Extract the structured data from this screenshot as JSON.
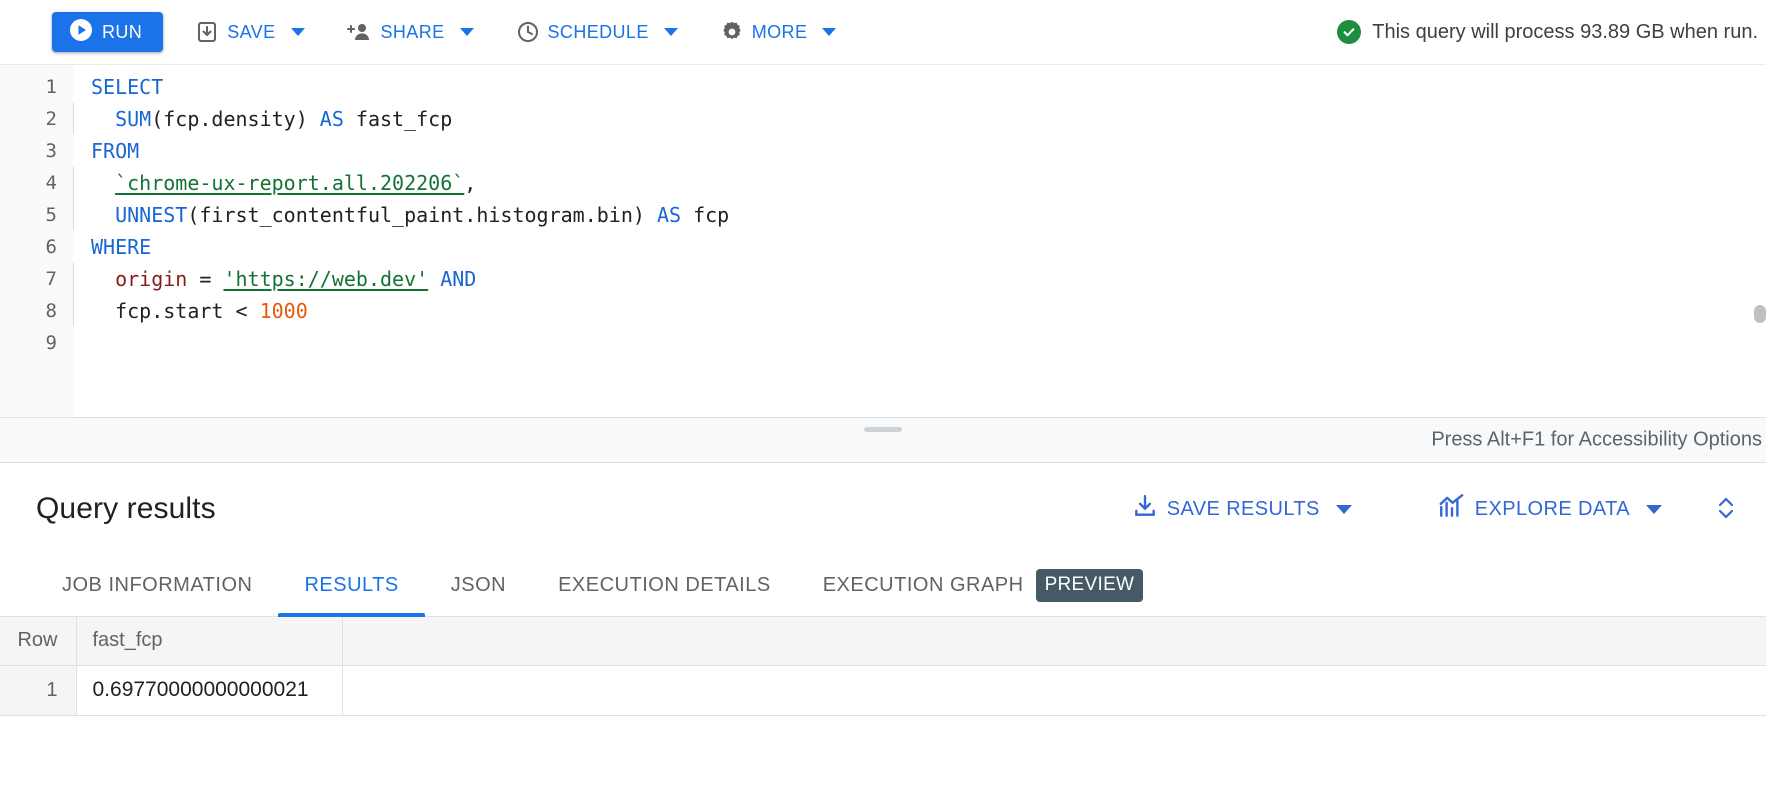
{
  "toolbar": {
    "run_label": "RUN",
    "items": [
      {
        "label": "SAVE",
        "icon": "save-icon",
        "has_caret": true
      },
      {
        "label": "SHARE",
        "icon": "share-icon",
        "has_caret": true
      },
      {
        "label": "SCHEDULE",
        "icon": "schedule-icon",
        "has_caret": true
      },
      {
        "label": "MORE",
        "icon": "gear-icon",
        "has_caret": true
      }
    ],
    "validation_message": "This query will process 93.89 GB when run.",
    "validation_icon": "check-circle-icon",
    "validation_color": "#1e8e3e",
    "accent_color": "#1a73e8"
  },
  "editor": {
    "line_numbers": [
      "1",
      "2",
      "3",
      "4",
      "5",
      "6",
      "7",
      "8",
      "9"
    ],
    "lines": [
      {
        "n": "1",
        "indent": false,
        "tokens": [
          {
            "t": "SELECT",
            "c": "k"
          }
        ]
      },
      {
        "n": "2",
        "indent": true,
        "tokens": [
          {
            "t": "  ",
            "c": "p"
          },
          {
            "t": "SUM",
            "c": "k"
          },
          {
            "t": "(fcp.density) ",
            "c": "p"
          },
          {
            "t": "AS",
            "c": "k"
          },
          {
            "t": " fast_fcp",
            "c": "p"
          }
        ]
      },
      {
        "n": "3",
        "indent": false,
        "tokens": [
          {
            "t": "FROM",
            "c": "k"
          }
        ]
      },
      {
        "n": "4",
        "indent": true,
        "tokens": [
          {
            "t": "  ",
            "c": "p"
          },
          {
            "t": "`chrome-ux-report.all.202206`",
            "c": "s"
          },
          {
            "t": ",",
            "c": "p"
          }
        ]
      },
      {
        "n": "5",
        "indent": true,
        "tokens": [
          {
            "t": "  ",
            "c": "p"
          },
          {
            "t": "UNNEST",
            "c": "k"
          },
          {
            "t": "(first_contentful_paint.histogram.bin) ",
            "c": "p"
          },
          {
            "t": "AS",
            "c": "k"
          },
          {
            "t": " fcp",
            "c": "p"
          }
        ]
      },
      {
        "n": "6",
        "indent": false,
        "tokens": [
          {
            "t": "WHERE",
            "c": "k"
          }
        ]
      },
      {
        "n": "7",
        "indent": true,
        "tokens": [
          {
            "t": "  ",
            "c": "p"
          },
          {
            "t": "origin",
            "c": "id"
          },
          {
            "t": " = ",
            "c": "p"
          },
          {
            "t": "'https://web.dev'",
            "c": "s"
          },
          {
            "t": " ",
            "c": "p"
          },
          {
            "t": "AND",
            "c": "k"
          }
        ]
      },
      {
        "n": "8",
        "indent": true,
        "tokens": [
          {
            "t": "  ",
            "c": "p"
          },
          {
            "t": "fcp.start ",
            "c": "p"
          },
          {
            "t": "<",
            "c": "p"
          },
          {
            "t": " 1000",
            "c": "n"
          }
        ]
      },
      {
        "n": "9",
        "indent": false,
        "tokens": []
      }
    ],
    "colors": {
      "keyword": "#1967d2",
      "string": "#137333",
      "identifier": "#8b1a1a",
      "number": "#e8590c",
      "plain": "#202124"
    }
  },
  "splitter": {
    "accessibility_hint": "Press Alt+F1 for Accessibility Options"
  },
  "results": {
    "title": "Query results",
    "save_results_label": "SAVE RESULTS",
    "save_results_icon": "download-icon",
    "explore_data_label": "EXPLORE DATA",
    "explore_data_icon": "chart-trend-icon",
    "expand_toggle_icon": "expand-collapse-icon",
    "tabs": [
      {
        "label": "JOB INFORMATION",
        "active": false,
        "badge": null
      },
      {
        "label": "RESULTS",
        "active": true,
        "badge": null
      },
      {
        "label": "JSON",
        "active": false,
        "badge": null
      },
      {
        "label": "EXECUTION DETAILS",
        "active": false,
        "badge": null
      },
      {
        "label": "EXECUTION GRAPH",
        "active": false,
        "badge": "PREVIEW"
      }
    ],
    "badge_color": "#455a64",
    "table": {
      "columns": [
        "Row",
        "fast_fcp"
      ],
      "rows": [
        {
          "row": "1",
          "fast_fcp": "0.69770000000000021"
        }
      ]
    }
  }
}
